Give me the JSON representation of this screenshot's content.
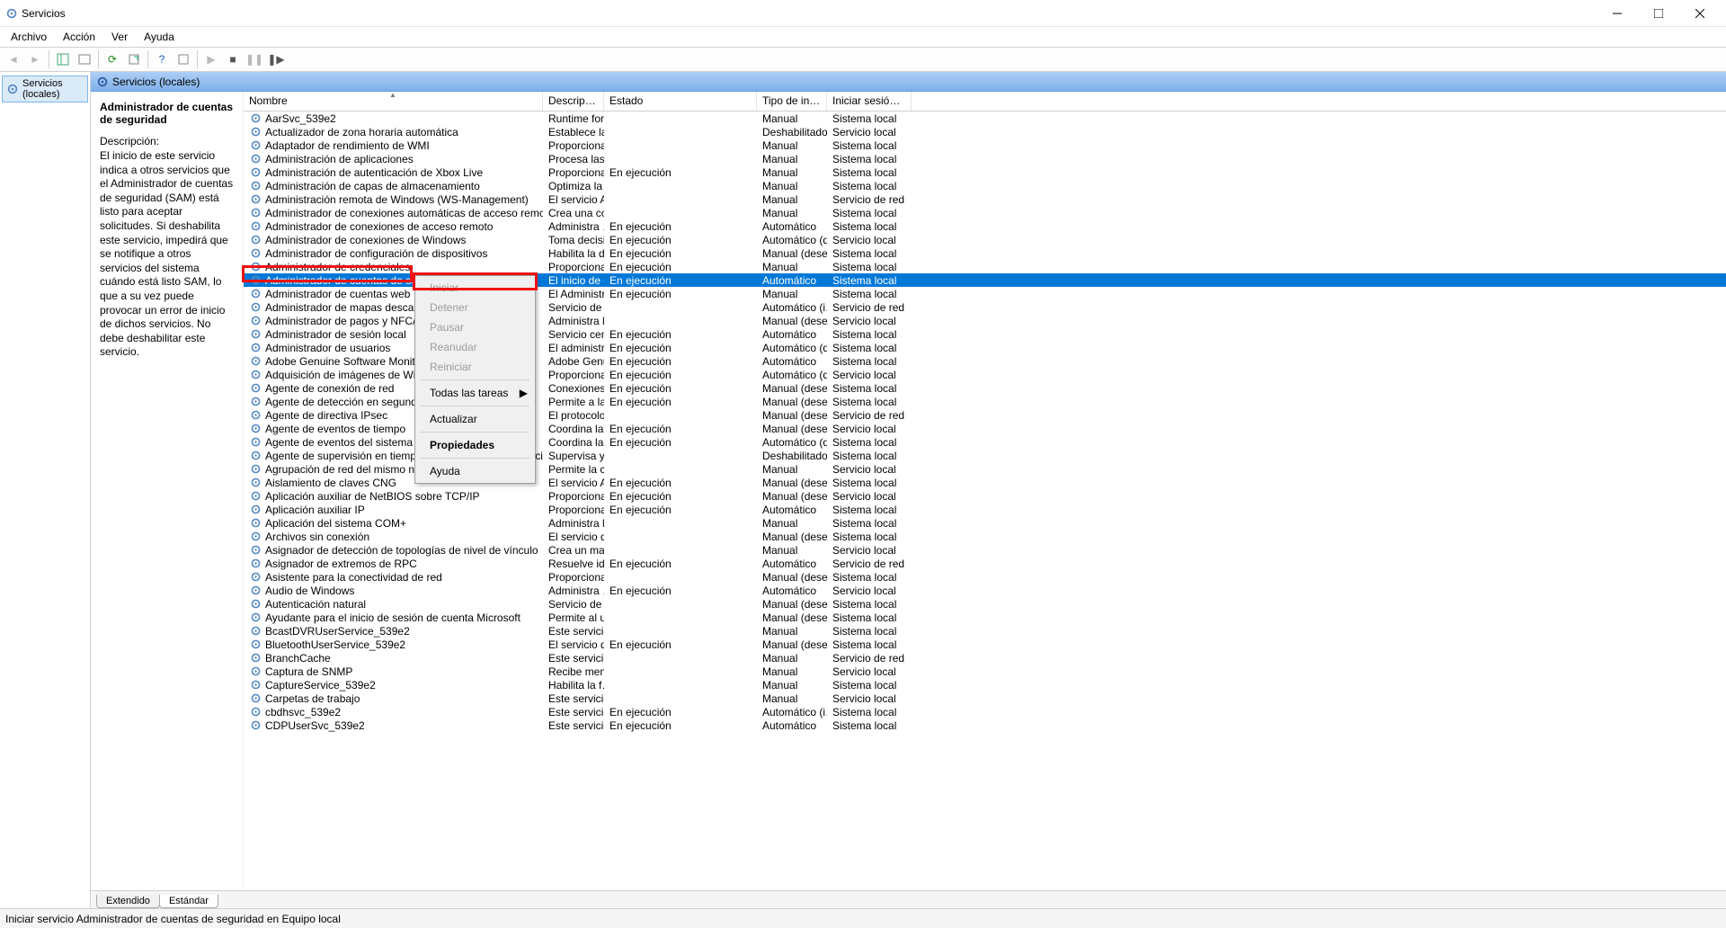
{
  "window": {
    "title": "Servicios"
  },
  "menubar": {
    "items": [
      "Archivo",
      "Acción",
      "Ver",
      "Ayuda"
    ]
  },
  "tree": {
    "root": "Servicios (locales)"
  },
  "paneheader": "Servicios (locales)",
  "detail": {
    "name": "Administrador de cuentas de seguridad",
    "descLabel": "Descripción:",
    "desc": "El inicio de este servicio indica a otros servicios que el Administrador de cuentas de seguridad (SAM) está listo para aceptar solicitudes. Si deshabilita este servicio, impedirá que se notifique a otros servicios del sistema cuándo está listo SAM, lo que a su vez puede provocar un error de inicio de dichos servicios. No debe deshabilitar este servicio."
  },
  "columns": {
    "name": "Nombre",
    "desc": "Descripción",
    "estado": "Estado",
    "tipo": "Tipo de inicio",
    "logon": "Iniciar sesión como"
  },
  "ctxmenu": {
    "iniciar": "Iniciar",
    "detener": "Detener",
    "pausar": "Pausar",
    "reanudar": "Reanudar",
    "reiniciar": "Reiniciar",
    "todas": "Todas las tareas",
    "actualizar": "Actualizar",
    "prop": "Propiedades",
    "ayuda": "Ayuda"
  },
  "tabs": {
    "ext": "Extendido",
    "std": "Estándar"
  },
  "statusbar": "Iniciar servicio Administrador de cuentas de seguridad en Equipo local",
  "services": [
    {
      "n": "AarSvc_539e2",
      "d": "Runtime for …",
      "e": "",
      "t": "Manual",
      "l": "Sistema local"
    },
    {
      "n": "Actualizador de zona horaria automática",
      "d": "Establece la …",
      "e": "",
      "t": "Deshabilitado",
      "l": "Servicio local"
    },
    {
      "n": "Adaptador de rendimiento de WMI",
      "d": "Proporciona…",
      "e": "",
      "t": "Manual",
      "l": "Sistema local"
    },
    {
      "n": "Administración de aplicaciones",
      "d": "Procesa las s…",
      "e": "",
      "t": "Manual",
      "l": "Sistema local"
    },
    {
      "n": "Administración de autenticación de Xbox Live",
      "d": "Proporciona…",
      "e": "En ejecución",
      "t": "Manual",
      "l": "Sistema local"
    },
    {
      "n": "Administración de capas de almacenamiento",
      "d": "Optimiza la …",
      "e": "",
      "t": "Manual",
      "l": "Sistema local"
    },
    {
      "n": "Administración remota de Windows (WS-Management)",
      "d": "El servicio A…",
      "e": "",
      "t": "Manual",
      "l": "Servicio de red"
    },
    {
      "n": "Administrador de conexiones automáticas de acceso remoto",
      "d": "Crea una co…",
      "e": "",
      "t": "Manual",
      "l": "Sistema local"
    },
    {
      "n": "Administrador de conexiones de acceso remoto",
      "d": "Administra …",
      "e": "En ejecución",
      "t": "Automático",
      "l": "Sistema local"
    },
    {
      "n": "Administrador de conexiones de Windows",
      "d": "Toma decisi…",
      "e": "En ejecución",
      "t": "Automático (d…",
      "l": "Servicio local"
    },
    {
      "n": "Administrador de configuración de dispositivos",
      "d": "Habilita la d…",
      "e": "En ejecución",
      "t": "Manual (dese…",
      "l": "Sistema local"
    },
    {
      "n": "Administrador de credenciales",
      "d": "Proporciona…",
      "e": "En ejecución",
      "t": "Manual",
      "l": "Sistema local"
    },
    {
      "n": "Administrador de cuentas de seguridad",
      "d": "El inicio de e…",
      "e": "En ejecución",
      "t": "Automático",
      "l": "Sistema local",
      "sel": true
    },
    {
      "n": "Administrador de cuentas web",
      "d": "El Administr…",
      "e": "En ejecución",
      "t": "Manual",
      "l": "Sistema local"
    },
    {
      "n": "Administrador de mapas descargados",
      "d": "Servicio de …",
      "e": "",
      "t": "Automático (i…",
      "l": "Servicio de red"
    },
    {
      "n": "Administrador de pagos y NFC/SE",
      "d": "Administra l…",
      "e": "",
      "t": "Manual (dese…",
      "l": "Servicio local"
    },
    {
      "n": "Administrador de sesión local",
      "d": "Servicio cen…",
      "e": "En ejecución",
      "t": "Automático",
      "l": "Sistema local"
    },
    {
      "n": "Administrador de usuarios",
      "d": "El administr…",
      "e": "En ejecución",
      "t": "Automático (d…",
      "l": "Sistema local"
    },
    {
      "n": "Adobe Genuine Software Monitor Service",
      "d": "Adobe Genu…",
      "e": "En ejecución",
      "t": "Automático",
      "l": "Sistema local"
    },
    {
      "n": "Adquisición de imágenes de Windows (WIA)",
      "d": "Proporciona…",
      "e": "En ejecución",
      "t": "Automático (d…",
      "l": "Servicio local"
    },
    {
      "n": "Agente de conexión de red",
      "d": "Conexiones …",
      "e": "En ejecución",
      "t": "Manual (dese…",
      "l": "Sistema local"
    },
    {
      "n": "Agente de detección en segundo plano de DevQuery",
      "d": "Permite a la…",
      "e": "En ejecución",
      "t": "Manual (dese…",
      "l": "Sistema local"
    },
    {
      "n": "Agente de directiva IPsec",
      "d": "El protocolo…",
      "e": "",
      "t": "Manual (dese…",
      "l": "Servicio de red"
    },
    {
      "n": "Agente de eventos de tiempo",
      "d": "Coordina la …",
      "e": "En ejecución",
      "t": "Manual (dese…",
      "l": "Servicio local"
    },
    {
      "n": "Agente de eventos del sistema",
      "d": "Coordina la …",
      "e": "En ejecución",
      "t": "Automático (d…",
      "l": "Sistema local"
    },
    {
      "n": "Agente de supervisión en tiempo de ejecución de Protección del sistema",
      "d": "Supervisa y …",
      "e": "",
      "t": "Deshabilitado",
      "l": "Sistema local"
    },
    {
      "n": "Agrupación de red del mismo nivel",
      "d": "Permite la c…",
      "e": "",
      "t": "Manual",
      "l": "Servicio local"
    },
    {
      "n": "Aislamiento de claves CNG",
      "d": "El servicio Ai…",
      "e": "En ejecución",
      "t": "Manual (dese…",
      "l": "Sistema local"
    },
    {
      "n": "Aplicación auxiliar de NetBIOS sobre TCP/IP",
      "d": "Proporciona…",
      "e": "En ejecución",
      "t": "Manual (dese…",
      "l": "Servicio local"
    },
    {
      "n": "Aplicación auxiliar IP",
      "d": "Proporciona…",
      "e": "En ejecución",
      "t": "Automático",
      "l": "Sistema local"
    },
    {
      "n": "Aplicación del sistema COM+",
      "d": "Administra l…",
      "e": "",
      "t": "Manual",
      "l": "Sistema local"
    },
    {
      "n": "Archivos sin conexión",
      "d": "El servicio d…",
      "e": "",
      "t": "Manual (dese…",
      "l": "Sistema local"
    },
    {
      "n": "Asignador de detección de topologías de nivel de vínculo",
      "d": "Crea un ma…",
      "e": "",
      "t": "Manual",
      "l": "Servicio local"
    },
    {
      "n": "Asignador de extremos de RPC",
      "d": "Resuelve ide…",
      "e": "En ejecución",
      "t": "Automático",
      "l": "Servicio de red"
    },
    {
      "n": "Asistente para la conectividad de red",
      "d": "Proporciona…",
      "e": "",
      "t": "Manual (dese…",
      "l": "Sistema local"
    },
    {
      "n": "Audio de Windows",
      "d": "Administra …",
      "e": "En ejecución",
      "t": "Automático",
      "l": "Servicio local"
    },
    {
      "n": "Autenticación natural",
      "d": "Servicio de a…",
      "e": "",
      "t": "Manual (dese…",
      "l": "Sistema local"
    },
    {
      "n": "Ayudante para el inicio de sesión de cuenta Microsoft",
      "d": "Permite al u…",
      "e": "",
      "t": "Manual (dese…",
      "l": "Sistema local"
    },
    {
      "n": "BcastDVRUserService_539e2",
      "d": "Este servicio…",
      "e": "",
      "t": "Manual",
      "l": "Sistema local"
    },
    {
      "n": "BluetoothUserService_539e2",
      "d": "El servicio d…",
      "e": "En ejecución",
      "t": "Manual (dese…",
      "l": "Sistema local"
    },
    {
      "n": "BranchCache",
      "d": "Este servicio…",
      "e": "",
      "t": "Manual",
      "l": "Servicio de red"
    },
    {
      "n": "Captura de SNMP",
      "d": "Recibe men…",
      "e": "",
      "t": "Manual",
      "l": "Servicio local"
    },
    {
      "n": "CaptureService_539e2",
      "d": "Habilita la f…",
      "e": "",
      "t": "Manual",
      "l": "Sistema local"
    },
    {
      "n": "Carpetas de trabajo",
      "d": "Este servicio…",
      "e": "",
      "t": "Manual",
      "l": "Servicio local"
    },
    {
      "n": "cbdhsvc_539e2",
      "d": "Este servicio…",
      "e": "En ejecución",
      "t": "Automático (i…",
      "l": "Sistema local"
    },
    {
      "n": "CDPUserSvc_539e2",
      "d": "Este servicio…",
      "e": "En ejecución",
      "t": "Automático",
      "l": "Sistema local"
    }
  ]
}
